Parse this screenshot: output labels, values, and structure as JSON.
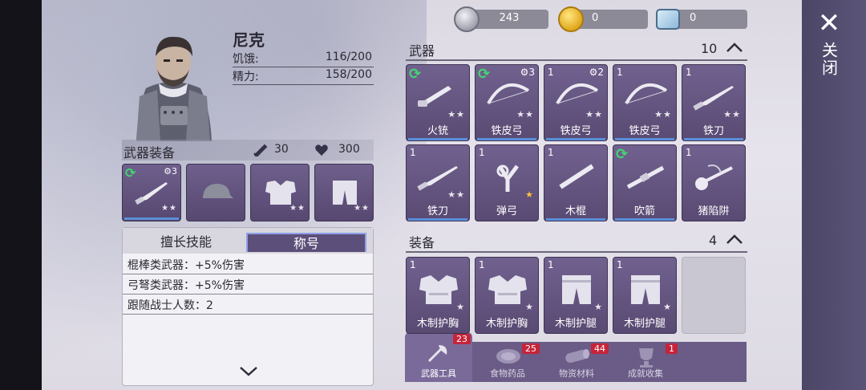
{
  "currency": {
    "silver": "243",
    "gold": "0",
    "ticket": "0"
  },
  "close_label": "关闭",
  "character": {
    "name": "尼克",
    "stats": [
      {
        "label": "饥饿:",
        "value": "116/200"
      },
      {
        "label": "精力:",
        "value": "158/200"
      }
    ]
  },
  "equipment": {
    "title": "武器装备",
    "attack": "30",
    "health": "300",
    "slots": [
      {
        "gear": "3"
      }
    ]
  },
  "skills": {
    "tabs": [
      "擅长技能",
      "称号"
    ],
    "rows": [
      "棍棒类武器：+5%伤害",
      "弓弩类武器：+5%伤害",
      "跟随战士人数：2"
    ]
  },
  "weapons": {
    "title": "武器",
    "count": "10",
    "items": [
      {
        "qty": "",
        "gear": "",
        "name": "火铳",
        "recycle": true,
        "icon": "musket-icon"
      },
      {
        "qty": "",
        "gear": "3",
        "name": "铁皮弓",
        "recycle": true,
        "icon": "bow-icon"
      },
      {
        "qty": "1",
        "gear": "2",
        "name": "铁皮弓",
        "recycle": false,
        "icon": "bow-icon"
      },
      {
        "qty": "1",
        "gear": "",
        "name": "铁皮弓",
        "recycle": false,
        "icon": "bow-icon"
      },
      {
        "qty": "1",
        "gear": "",
        "name": "铁刀",
        "recycle": false,
        "icon": "knife-icon"
      },
      {
        "qty": "1",
        "gear": "",
        "name": "铁刀",
        "recycle": false,
        "icon": "knife-icon"
      },
      {
        "qty": "1",
        "gear": "",
        "name": "弹弓",
        "recycle": false,
        "icon": "slingshot-icon"
      },
      {
        "qty": "1",
        "gear": "",
        "name": "木棍",
        "recycle": false,
        "icon": "stick-icon"
      },
      {
        "qty": "",
        "gear": "",
        "name": "吹箭",
        "recycle": true,
        "icon": "blowgun-icon"
      },
      {
        "qty": "1",
        "gear": "",
        "name": "猪陷阱",
        "recycle": false,
        "icon": "trap-icon"
      }
    ]
  },
  "gear_items": {
    "title": "装备",
    "count": "4",
    "items": [
      {
        "qty": "1",
        "name": "木制护胸",
        "icon": "chest-armor-icon"
      },
      {
        "qty": "1",
        "name": "木制护胸",
        "icon": "chest-armor-icon"
      },
      {
        "qty": "1",
        "name": "木制护腿",
        "icon": "leg-armor-icon"
      },
      {
        "qty": "1",
        "name": "木制护腿",
        "icon": "leg-armor-icon"
      }
    ]
  },
  "bottom_tabs": [
    {
      "label": "武器工具",
      "badge": "23",
      "icon": "axe-icon"
    },
    {
      "label": "食物药品",
      "badge": "25",
      "icon": "meat-icon"
    },
    {
      "label": "物资材料",
      "badge": "44",
      "icon": "log-icon"
    },
    {
      "label": "成就收集",
      "badge": "1",
      "icon": "trophy-icon"
    }
  ],
  "colors": {
    "card": "#594a73",
    "accent_bar": "#5a8fd8",
    "recycle": "#43d66f",
    "badge": "#c6243a"
  }
}
